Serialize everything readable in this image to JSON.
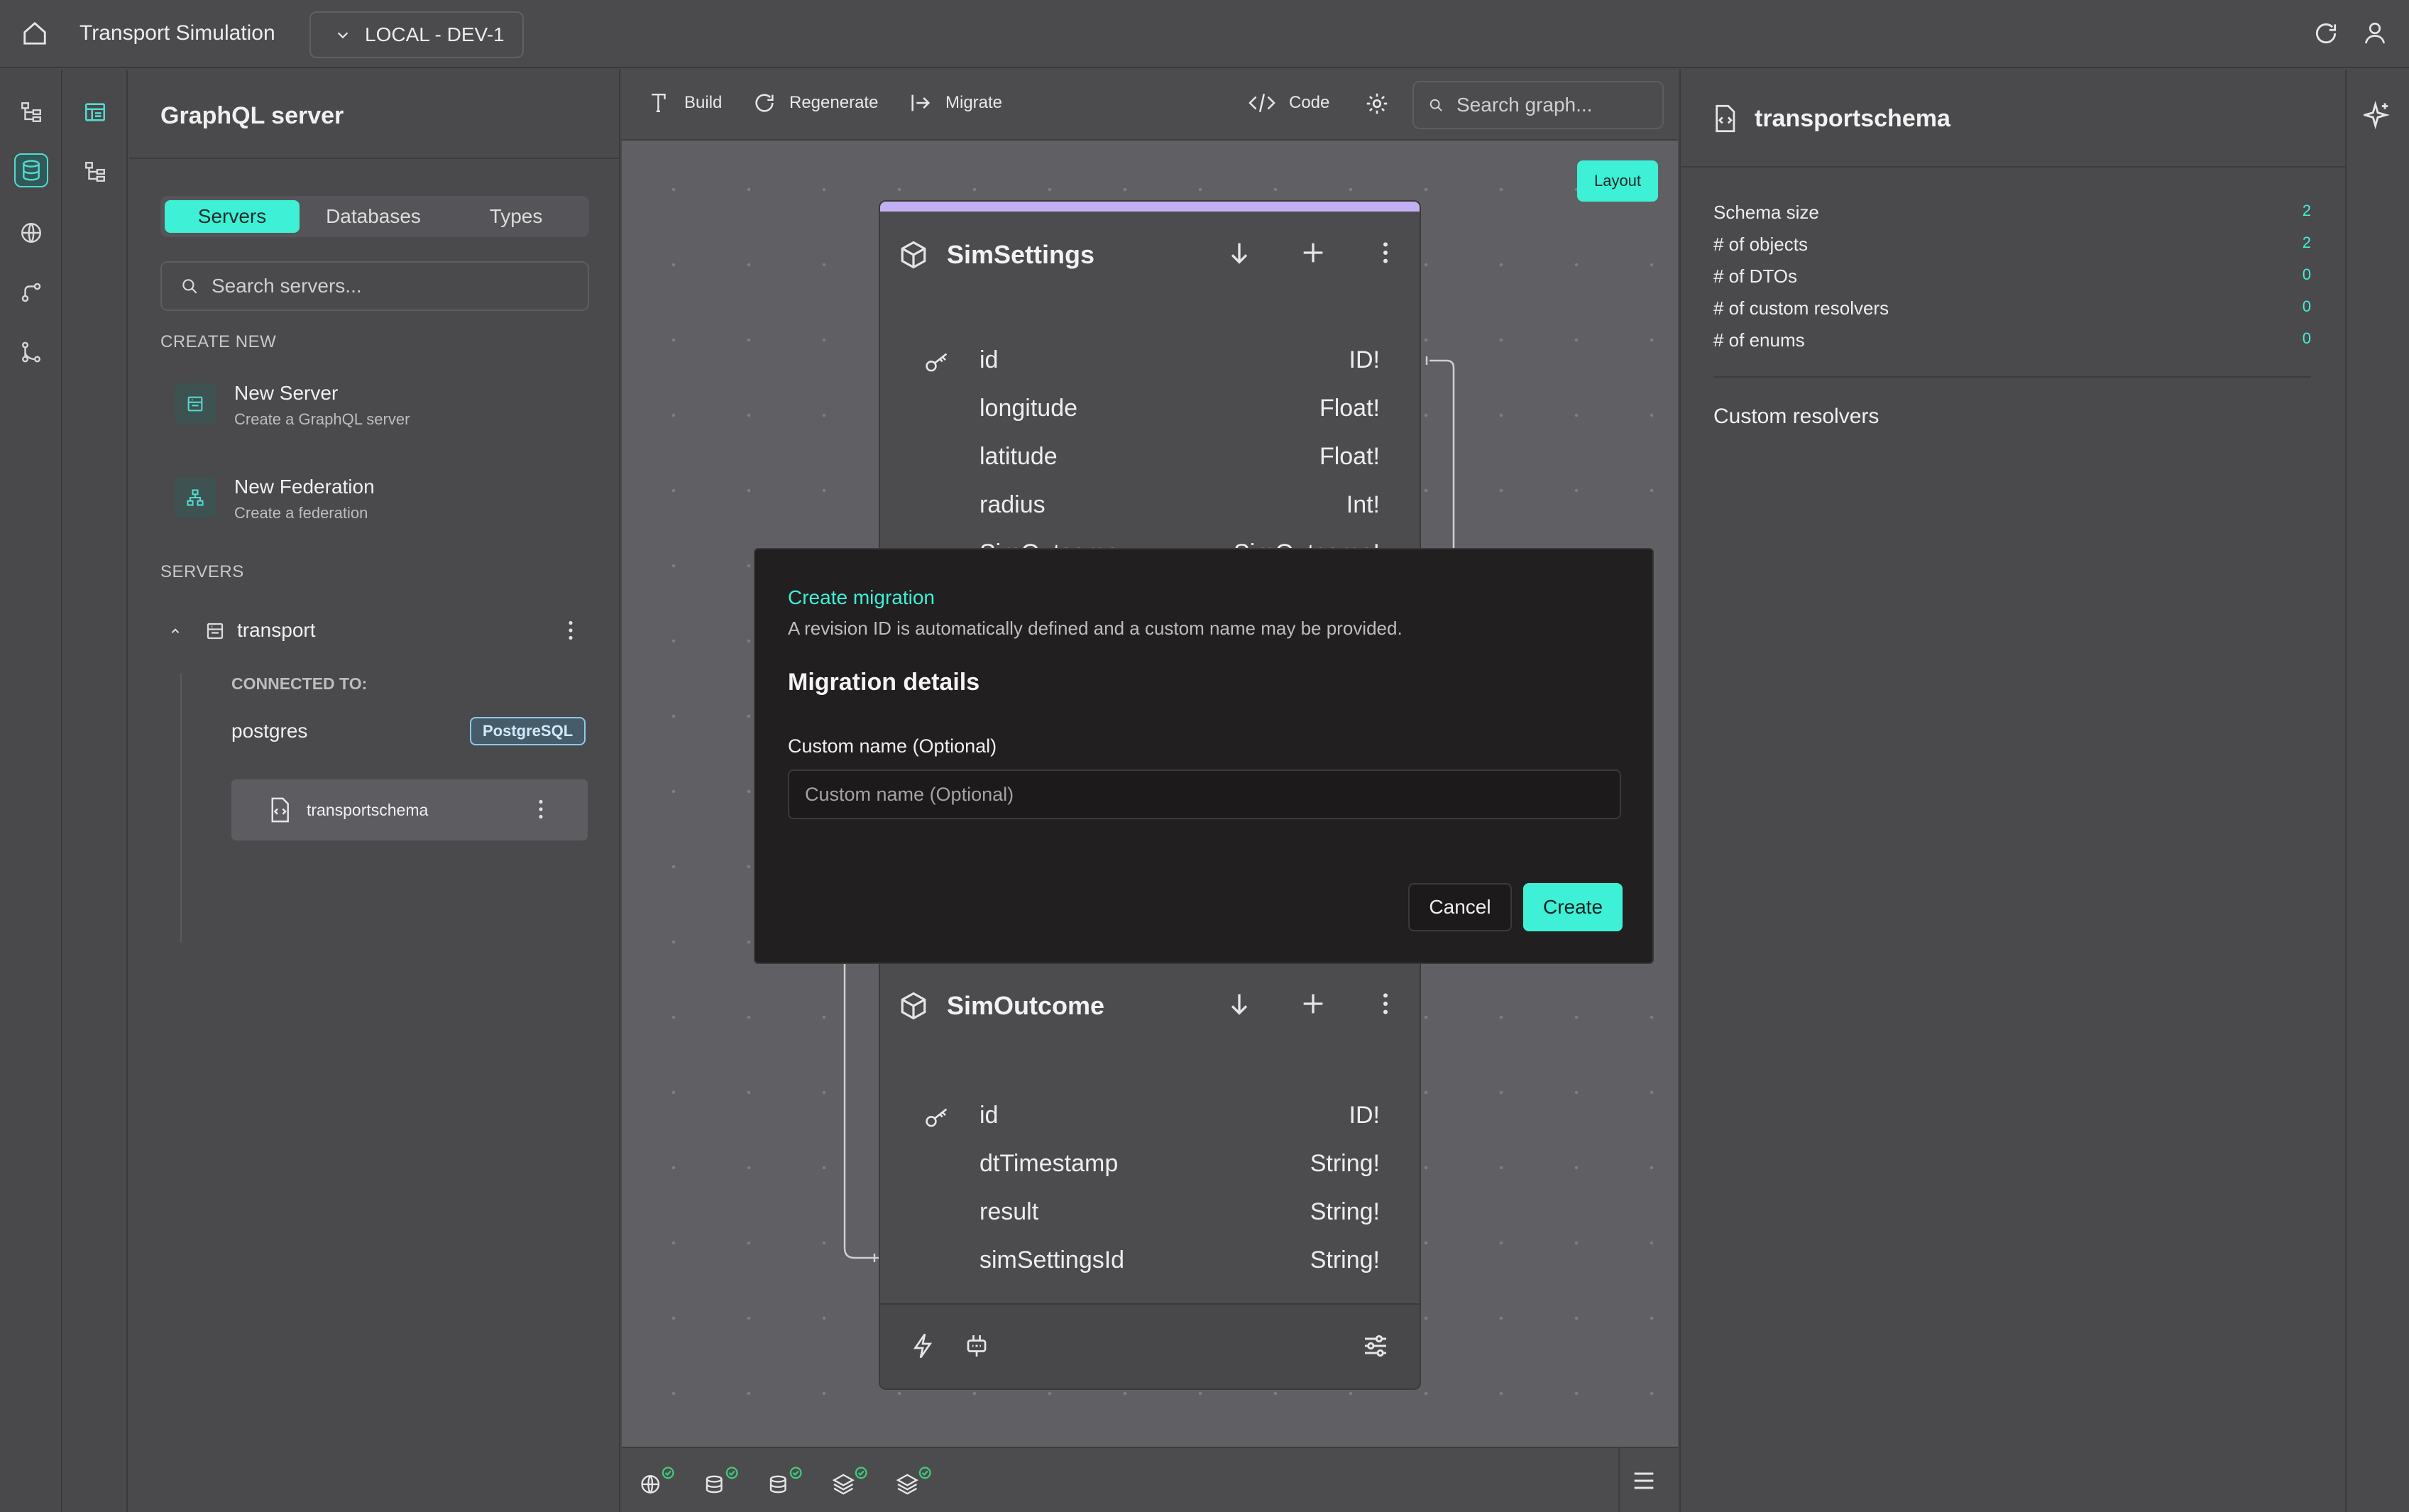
{
  "app": {
    "title": "Transport Simulation",
    "environment": "LOCAL - DEV-1"
  },
  "server_panel": {
    "title": "GraphQL server",
    "tabs": [
      {
        "label": "Servers",
        "active": true
      },
      {
        "label": "Databases",
        "active": false
      },
      {
        "label": "Types",
        "active": false
      }
    ],
    "search_placeholder": "Search servers...",
    "create_new_label": "CREATE NEW",
    "create_items": [
      {
        "title": "New Server",
        "subtitle": "Create a GraphQL server"
      },
      {
        "title": "New Federation",
        "subtitle": "Create a federation"
      }
    ],
    "servers_label": "SERVERS",
    "server": {
      "name": "transport",
      "connected_label": "CONNECTED TO:",
      "database": "postgres",
      "database_badge": "PostgreSQL",
      "schema": "transportschema"
    }
  },
  "toolbar": {
    "build": "Build",
    "regenerate": "Regenerate",
    "migrate": "Migrate",
    "code": "Code",
    "search_placeholder": "Search graph...",
    "layout": "Layout"
  },
  "nodes": [
    {
      "name": "SimSettings",
      "fields": [
        {
          "name": "id",
          "type": "ID!",
          "key": true
        },
        {
          "name": "longitude",
          "type": "Float!"
        },
        {
          "name": "latitude",
          "type": "Float!"
        },
        {
          "name": "radius",
          "type": "Int!"
        },
        {
          "name": "SimOutcome",
          "type": "SimOutcome!"
        }
      ]
    },
    {
      "name": "SimOutcome",
      "fields": [
        {
          "name": "id",
          "type": "ID!",
          "key": true
        },
        {
          "name": "dtTimestamp",
          "type": "String!"
        },
        {
          "name": "result",
          "type": "String!"
        },
        {
          "name": "simSettingsId",
          "type": "String!"
        }
      ]
    }
  ],
  "right_panel": {
    "title": "transportschema",
    "stats": [
      {
        "label": "Schema size",
        "value": "2"
      },
      {
        "label": "# of objects",
        "value": "2"
      },
      {
        "label": "# of DTOs",
        "value": "0"
      },
      {
        "label": "# of custom resolvers",
        "value": "0"
      },
      {
        "label": "# of enums",
        "value": "0"
      }
    ],
    "custom_resolvers": "Custom resolvers"
  },
  "modal": {
    "kicker": "Create migration",
    "description": "A revision ID is automatically defined and a custom name may be provided.",
    "heading": "Migration details",
    "field_label": "Custom name (Optional)",
    "field_placeholder": "Custom name (Optional)",
    "field_value": "",
    "cancel": "Cancel",
    "create": "Create"
  },
  "colors": {
    "accent": "#3ef0d6",
    "node_stripe": "#c3b0f2",
    "badge_blue": "#8ec8ea"
  }
}
